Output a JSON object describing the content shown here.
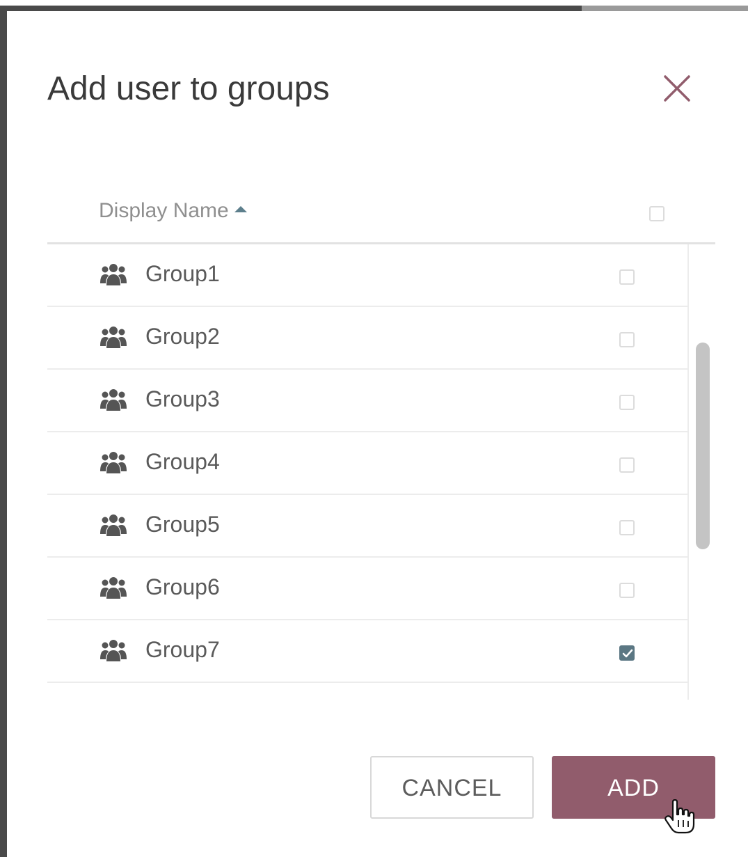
{
  "dialog": {
    "title": "Add user to groups",
    "close_icon": "close-icon",
    "accent_color": "#915c6c"
  },
  "table": {
    "column_header": "Display Name",
    "sort_direction": "ascending",
    "select_all_checked": false,
    "rows": [
      {
        "label": "Group1",
        "icon": "group-icon",
        "checked": false
      },
      {
        "label": "Group2",
        "icon": "group-icon",
        "checked": false
      },
      {
        "label": "Group3",
        "icon": "group-icon",
        "checked": false
      },
      {
        "label": "Group4",
        "icon": "group-icon",
        "checked": false
      },
      {
        "label": "Group5",
        "icon": "group-icon",
        "checked": false
      },
      {
        "label": "Group6",
        "icon": "group-icon",
        "checked": false
      },
      {
        "label": "Group7",
        "icon": "group-icon",
        "checked": true
      }
    ]
  },
  "footer": {
    "cancel_label": "CANCEL",
    "add_label": "ADD"
  }
}
